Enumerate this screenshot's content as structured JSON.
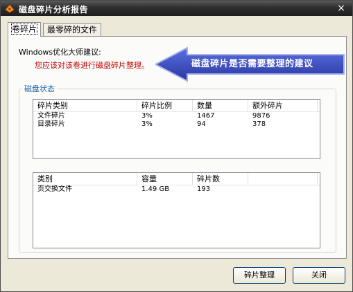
{
  "window": {
    "title": "磁盘碎片分析报告",
    "close_glyph": "×"
  },
  "tabs": [
    {
      "label": "卷碎片"
    },
    {
      "label": "最零碎的文件"
    }
  ],
  "advice": {
    "heading": "Windows优化大师建议:",
    "text": "您应该对该卷进行磁盘碎片整理。"
  },
  "callout": {
    "text": "磁盘碎片是否需要整理的建议"
  },
  "status_group": {
    "label": "磁盘状态"
  },
  "fragment_table": {
    "columns": [
      "碎片类别",
      "碎片比例",
      "数量",
      "额外碎片"
    ],
    "rows": [
      [
        "文件碎片",
        "3%",
        "1467",
        "9876"
      ],
      [
        "目录碎片",
        "3%",
        "94",
        "378"
      ]
    ]
  },
  "pagefile_table": {
    "columns": [
      "类别",
      "容量",
      "碎片数"
    ],
    "rows": [
      [
        "页交换文件",
        "1.49 GB",
        "193"
      ]
    ]
  },
  "buttons": {
    "defrag": "碎片整理",
    "close": "关闭"
  },
  "colors": {
    "advice_text": "#c00000",
    "group_label": "#1f5fa8",
    "callout_fill": "#3b4fc0"
  }
}
